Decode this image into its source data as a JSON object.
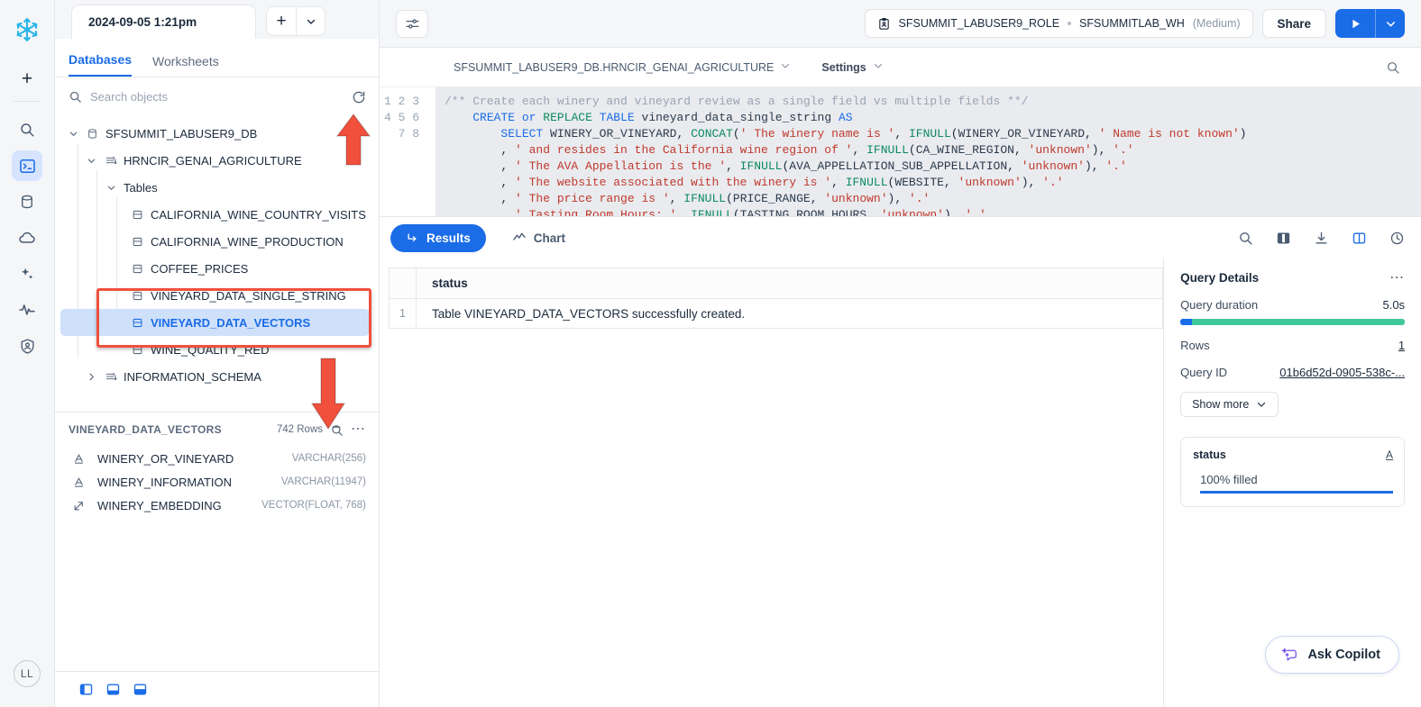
{
  "rail": {
    "logo": "snowflake-logo",
    "add_label": "+",
    "items": [
      {
        "name": "search",
        "icon": "search-icon"
      },
      {
        "name": "worksheets",
        "icon": "terminal-icon",
        "active": true
      },
      {
        "name": "data",
        "icon": "database-icon"
      },
      {
        "name": "cloud",
        "icon": "cloud-icon"
      },
      {
        "name": "ai-ml",
        "icon": "sparkle-icon"
      },
      {
        "name": "monitoring",
        "icon": "activity-icon"
      },
      {
        "name": "admin",
        "icon": "shield-user-icon"
      }
    ],
    "avatar_initials": "LL"
  },
  "browser": {
    "worksheet_tab": "2024-09-05 1:21pm",
    "add_tab_label": "+",
    "tabs": [
      {
        "label": "Databases",
        "active": true
      },
      {
        "label": "Worksheets",
        "active": false
      }
    ],
    "search": {
      "value": "",
      "placeholder": "Search objects"
    },
    "tree": [
      {
        "label": "SFSUMMIT_LABUSER9_DB",
        "level": 1,
        "icon": "database-icon",
        "chevron": "expanded"
      },
      {
        "label": "HRNCIR_GENAI_AGRICULTURE",
        "level": 2,
        "icon": "schema-icon",
        "chevron": "expanded"
      },
      {
        "label": "Tables",
        "level": 3,
        "icon": "",
        "chevron": "expanded"
      },
      {
        "label": "CALIFORNIA_WINE_COUNTRY_VISITS",
        "level": 4,
        "icon": "table-icon",
        "chevron": ""
      },
      {
        "label": "CALIFORNIA_WINE_PRODUCTION",
        "level": 4,
        "icon": "table-icon",
        "chevron": ""
      },
      {
        "label": "COFFEE_PRICES",
        "level": 4,
        "icon": "table-icon",
        "chevron": ""
      },
      {
        "label": "VINEYARD_DATA_SINGLE_STRING",
        "level": 4,
        "icon": "table-icon",
        "chevron": ""
      },
      {
        "label": "VINEYARD_DATA_VECTORS",
        "level": 4,
        "icon": "table-icon",
        "chevron": "",
        "selected": true
      },
      {
        "label": "WINE_QUALITY_RED",
        "level": 4,
        "icon": "table-icon",
        "chevron": ""
      },
      {
        "label": "INFORMATION_SCHEMA",
        "level": 2,
        "icon": "schema-icon",
        "chevron": "collapsed"
      }
    ],
    "detail": {
      "table_name": "VINEYARD_DATA_VECTORS",
      "row_count": "742 Rows",
      "preview_icon": "preview-table-icon",
      "more_icon": "more-options-icon",
      "columns": [
        {
          "name": "WINERY_OR_VINEYARD",
          "type": "VARCHAR(256)",
          "icon": "text-type-icon"
        },
        {
          "name": "WINERY_INFORMATION",
          "type": "VARCHAR(11947)",
          "icon": "text-type-icon"
        },
        {
          "name": "WINERY_EMBEDDING",
          "type": "VECTOR(FLOAT, 768)",
          "icon": "vector-type-icon"
        }
      ]
    },
    "footer_icons": [
      "panel-left-icon",
      "panel-bottom-icon",
      "panel-split-icon"
    ]
  },
  "main": {
    "filter_icon": "sliders-icon",
    "role": "SFSUMMIT_LABUSER9_ROLE",
    "role_icon": "role-badge-icon",
    "warehouse": "SFSUMMITLAB_WH",
    "warehouse_size": "(Medium)",
    "share_label": "Share",
    "run_icon": "play-icon",
    "run_caret_icon": "chevron-down-icon",
    "context_db": "SFSUMMIT_LABUSER9_DB.HRNCIR_GENAI_AGRICULTURE",
    "settings_label": "Settings",
    "editor_search_icon": "search-icon",
    "editor": {
      "line_numbers": [
        "1",
        "2",
        "3",
        "4",
        "5",
        "6",
        "7",
        "8"
      ],
      "lines": [
        "/** Create each winery and vineyard review as a single field vs multiple fields **/",
        "    CREATE or REPLACE TABLE vineyard_data_single_string AS",
        "        SELECT WINERY_OR_VINEYARD, CONCAT(' The winery name is ', IFNULL(WINERY_OR_VINEYARD, ' Name is not known')",
        "        , ' and resides in the California wine region of ', IFNULL(CA_WINE_REGION, 'unknown'), '.'",
        "        , ' The AVA Appellation is the ', IFNULL(AVA_APPELLATION_SUB_APPELLATION, 'unknown'), '.'",
        "        , ' The website associated with the winery is ', IFNULL(WEBSITE, 'unknown'), '.'",
        "        , ' The price range is ', IFNULL(PRICE_RANGE, 'unknown'), '.'",
        "        , ' Tasting Room Hours: ', IFNULL(TASTING_ROOM_HOURS, 'unknown'), '.'"
      ]
    },
    "result_tabs": [
      {
        "label": "Results",
        "icon": "results-arrow-icon",
        "active": true
      },
      {
        "label": "Chart",
        "icon": "chart-line-icon",
        "active": false
      }
    ],
    "result_toolbar_icons": [
      {
        "name": "search-results-icon",
        "active": false
      },
      {
        "name": "columns-icon",
        "active": false
      },
      {
        "name": "download-icon",
        "active": false
      },
      {
        "name": "side-panel-icon",
        "active": true
      },
      {
        "name": "query-history-icon",
        "active": false
      }
    ],
    "results_table": {
      "columns": [
        "status"
      ],
      "rows": [
        {
          "num": "1",
          "status": "Table VINEYARD_DATA_VECTORS successfully created."
        }
      ]
    },
    "query_details": {
      "title": "Query Details",
      "more_icon": "more-options-icon",
      "duration_label": "Query duration",
      "duration_value": "5.0s",
      "rows_label": "Rows",
      "rows_value": "1",
      "query_id_label": "Query ID",
      "query_id_value": "01b6d52d-0905-538c-...",
      "show_more_label": "Show more",
      "stat_card": {
        "column_name": "status",
        "type_icon": "text-type-icon",
        "fill_label": "100% filled"
      }
    },
    "copilot": {
      "label": "Ask Copilot",
      "icon": "copilot-sparkle-icon"
    }
  },
  "colors": {
    "accent": "#1a6ce7",
    "annotation": "#f0503c",
    "duration_bar": "#3fc79a",
    "selected_row": "#cfe0fb"
  }
}
